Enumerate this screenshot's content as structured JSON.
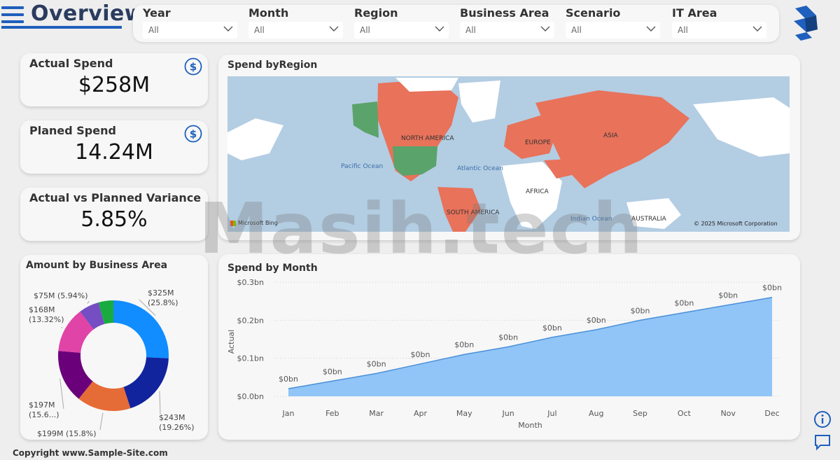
{
  "header": {
    "title": "Overview"
  },
  "filters": [
    {
      "label": "Year",
      "value": "All"
    },
    {
      "label": "Month",
      "value": "All"
    },
    {
      "label": "Region",
      "value": "All"
    },
    {
      "label": "Business Area",
      "value": "All"
    },
    {
      "label": "Scenario",
      "value": "All"
    },
    {
      "label": "IT Area",
      "value": "All"
    }
  ],
  "kpis": [
    {
      "label": "Actual Spend",
      "value": "$258M",
      "icon": "dollar-icon"
    },
    {
      "label": "Planed Spend",
      "value": "14.24M",
      "icon": "dollar-icon"
    },
    {
      "label": "Actual vs Planned Variance",
      "value": "5.85%"
    }
  ],
  "map": {
    "title": "Spend byRegion",
    "continent_labels": [
      "NORTH AMERICA",
      "EUROPE",
      "ASIA",
      "AFRICA",
      "SOUTH AMERICA",
      "AUSTRALIA"
    ],
    "ocean_labels": [
      "Pacific Ocean",
      "Atlantic Ocean",
      "Indian Ocean"
    ],
    "attribution_left": "Microsoft Bing",
    "attribution_right": "© 2025 Microsoft Corporation",
    "colors": {
      "ocean": "#b3cde3",
      "land": "#ffffff",
      "highlight": "#e8725a",
      "green": "#5aa36a"
    }
  },
  "watermark": "Masih.tech",
  "copyright": "Copyright www.Sample-Site.com",
  "chart_data": [
    {
      "type": "pie",
      "title": "Amount by Business Area",
      "donut": true,
      "slices": [
        {
          "value": 325,
          "label": "$325M",
          "pct": "(25.8%)",
          "color": "#118dff"
        },
        {
          "value": 243,
          "label": "$243M",
          "pct": "(19.26%)",
          "color": "#12239e"
        },
        {
          "value": 199,
          "label": "$199M (15.8%)",
          "color": "#e66c37"
        },
        {
          "value": 197,
          "label": "$197M",
          "pct": "(15.6...)",
          "color": "#6b007b"
        },
        {
          "value": 168,
          "label": "$168M",
          "pct": "(13.32%)",
          "color": "#e044a7"
        },
        {
          "value": 75,
          "label": "$75M (5.94%)",
          "color": "#744ec2"
        },
        {
          "value": 55,
          "color": "#1aab40"
        }
      ]
    },
    {
      "type": "area",
      "title": "Spend by Month",
      "xlabel": "Month",
      "ylabel": "Actual",
      "categories": [
        "Jan",
        "Feb",
        "Mar",
        "Apr",
        "May",
        "Jun",
        "Jul",
        "Aug",
        "Sep",
        "Oct",
        "Nov",
        "Dec"
      ],
      "values": [
        0.02,
        0.04,
        0.06,
        0.085,
        0.11,
        0.13,
        0.155,
        0.175,
        0.2,
        0.22,
        0.24,
        0.26
      ],
      "data_labels": [
        "$0bn",
        "$0bn",
        "$0bn",
        "$0bn",
        "$0bn",
        "$0bn",
        "$0bn",
        "$0bn",
        "$0bn",
        "$0bn",
        "$0bn",
        "$0bn"
      ],
      "yticks": [
        0,
        0.1,
        0.2,
        0.3
      ],
      "ytick_labels": [
        "$0.0bn",
        "$0.1bn",
        "$0.2bn",
        "$0.3bn"
      ],
      "ylim": [
        0,
        0.3
      ],
      "color": "#91c5f7",
      "line_color": "#4a90d9"
    }
  ]
}
